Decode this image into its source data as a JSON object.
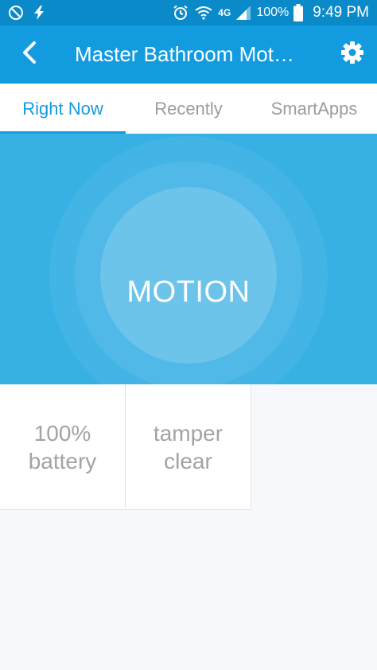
{
  "status_bar": {
    "battery_percent": "100%",
    "network": "4G",
    "time": "9:49 PM"
  },
  "app_bar": {
    "title": "Master Bathroom Mot…",
    "back_icon": "back-arrow-icon",
    "settings_icon": "gear-icon"
  },
  "tabs": [
    {
      "label": "Right Now",
      "active": true
    },
    {
      "label": "Recently",
      "active": false
    },
    {
      "label": "SmartApps",
      "active": false
    }
  ],
  "hero": {
    "state_label": "MOTION"
  },
  "tiles": [
    {
      "line1": "100%",
      "line2": "battery"
    },
    {
      "line1": "tamper",
      "line2": "clear"
    }
  ],
  "colors": {
    "status_bar": "#0b8ac9",
    "app_bar": "#139be0",
    "hero": "#37b0e4",
    "tab_active": "#139be0",
    "tab_inactive": "#9c9c9c",
    "tile_text": "#a3a3a3",
    "background": "#f6f8fc"
  }
}
